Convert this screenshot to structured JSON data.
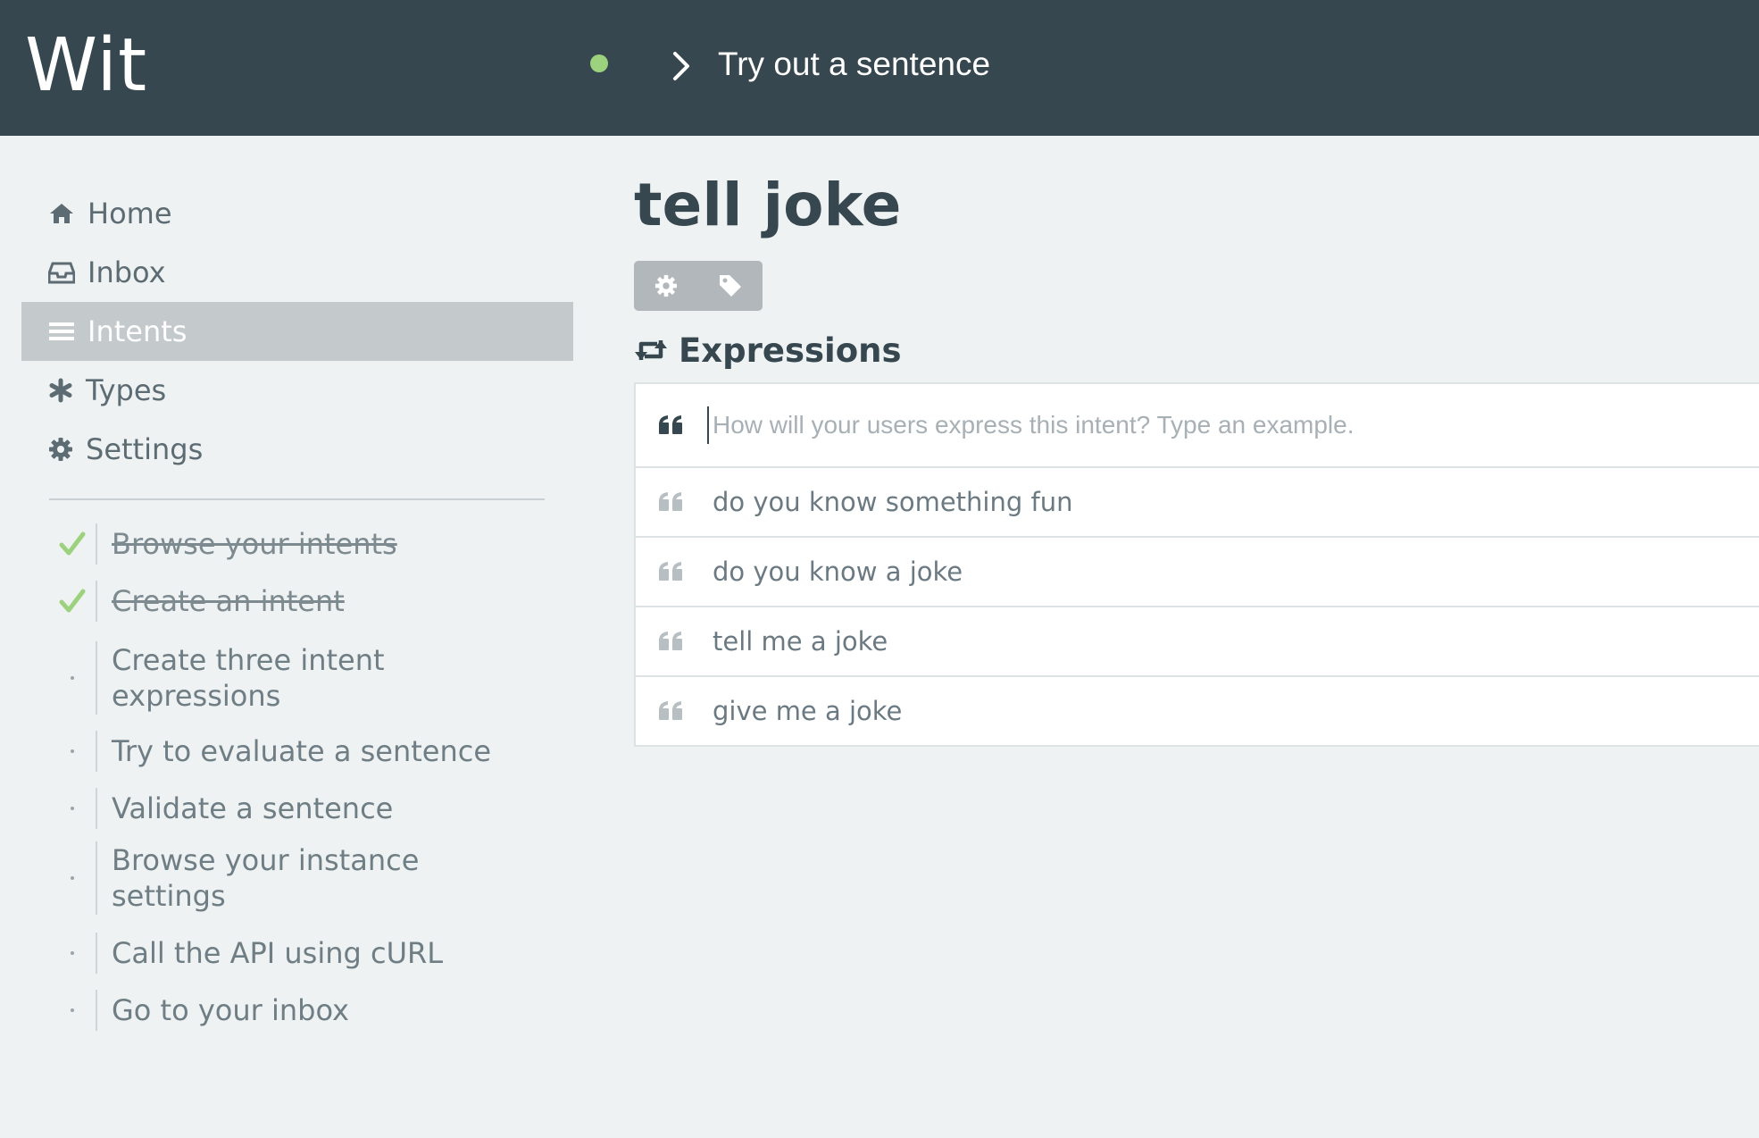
{
  "header": {
    "logo": "Wit",
    "status": "online",
    "try_sentence_placeholder": "Try out a sentence",
    "colors": {
      "background": "#37474f",
      "status_dot": "#9cd27e"
    }
  },
  "sidebar": {
    "nav": [
      {
        "label": "Home",
        "icon": "home-icon",
        "active": false
      },
      {
        "label": "Inbox",
        "icon": "inbox-icon",
        "active": false
      },
      {
        "label": "Intents",
        "icon": "list-icon",
        "active": true
      },
      {
        "label": "Types",
        "icon": "asterisk-icon",
        "active": false
      },
      {
        "label": "Settings",
        "icon": "gear-icon",
        "active": false
      }
    ],
    "tasks": [
      {
        "label": "Browse your intents",
        "done": true
      },
      {
        "label": "Create an intent",
        "done": true
      },
      {
        "label": "Create three intent expressions",
        "done": false
      },
      {
        "label": "Try to evaluate a sentence",
        "done": false
      },
      {
        "label": "Validate a sentence",
        "done": false
      },
      {
        "label": "Browse your instance settings",
        "done": false
      },
      {
        "label": "Call the API using cURL",
        "done": false
      },
      {
        "label": "Go to your inbox",
        "done": false
      }
    ]
  },
  "main": {
    "intent_name": "tell joke",
    "toolbar": [
      {
        "icon": "gear-icon"
      },
      {
        "icon": "tag-icon"
      }
    ],
    "expressions_heading": "Expressions",
    "expression_input_placeholder": "How will your users express this intent? Type an example.",
    "expressions": [
      "do you know something fun",
      "do you know a joke",
      "tell me a joke",
      "give me a joke"
    ]
  }
}
